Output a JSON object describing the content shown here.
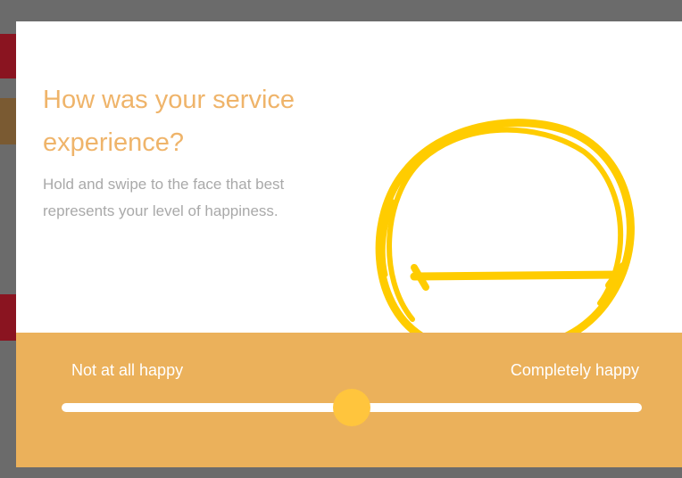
{
  "survey": {
    "title": "How was your service experience?",
    "instructions": "Hold and swipe to the face that best represents your level of happiness.",
    "face_icon": "neutral-face-icon",
    "face_color": "#ffcc00"
  },
  "scale": {
    "min_label": "Not at all happy",
    "max_label": "Completely happy",
    "value": 0.5
  },
  "colors": {
    "title": "#efb46a",
    "panel": "#ebb15b",
    "thumb": "#ffc53d",
    "text_muted": "#a9a9a9"
  }
}
